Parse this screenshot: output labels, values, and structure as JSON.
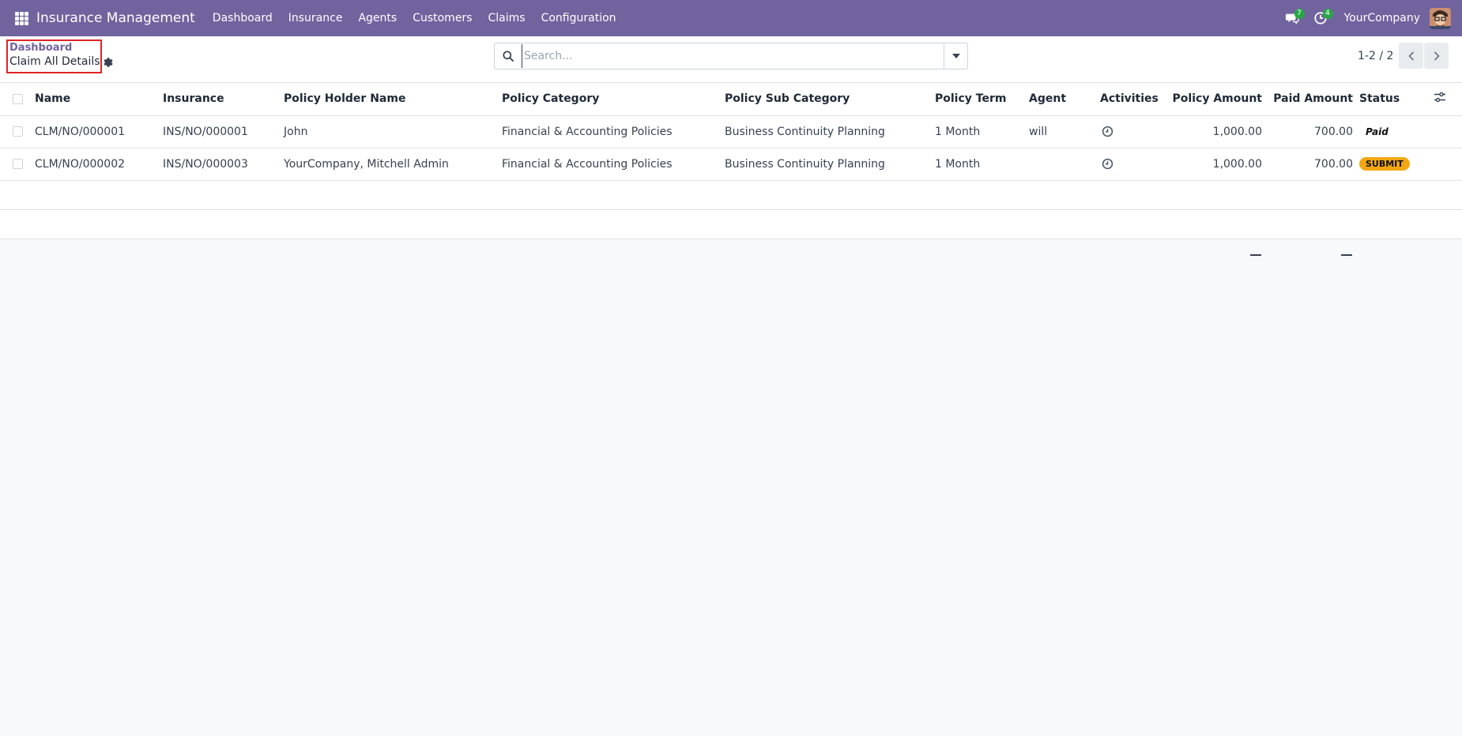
{
  "navbar": {
    "brand": "Insurance Management",
    "menu": [
      "Dashboard",
      "Insurance",
      "Agents",
      "Customers",
      "Claims",
      "Configuration"
    ],
    "messages_count": "7",
    "activities_count": "4",
    "company": "YourCompany",
    "accent": "#71639e"
  },
  "breadcrumb": {
    "parent": "Dashboard",
    "current": "Claim All Details"
  },
  "search": {
    "placeholder": "Search..."
  },
  "pager": {
    "value": "1-2 / 2"
  },
  "table": {
    "columns": [
      "Name",
      "Insurance",
      "Policy Holder Name",
      "Policy Category",
      "Policy Sub Category",
      "Policy Term",
      "Agent",
      "Activities",
      "Policy Amount",
      "Paid Amount",
      "Status"
    ],
    "rows": [
      {
        "name": "CLM/NO/000001",
        "insurance": "INS/NO/000001",
        "holder": "John",
        "category": "Financial & Accounting Policies",
        "sub_category": "Business Continuity Planning",
        "term": "1 Month",
        "agent": "will",
        "policy_amount": "1,000.00",
        "paid_amount": "700.00",
        "status": "Paid"
      },
      {
        "name": "CLM/NO/000002",
        "insurance": "INS/NO/000003",
        "holder": "YourCompany, Mitchell Admin",
        "category": "Financial & Accounting Policies",
        "sub_category": "Business Continuity Planning",
        "term": "1 Month",
        "agent": "",
        "policy_amount": "1,000.00",
        "paid_amount": "700.00",
        "status": "SUBMIT"
      }
    ],
    "status_colors": {
      "SUBMIT": "#f3a712"
    }
  }
}
